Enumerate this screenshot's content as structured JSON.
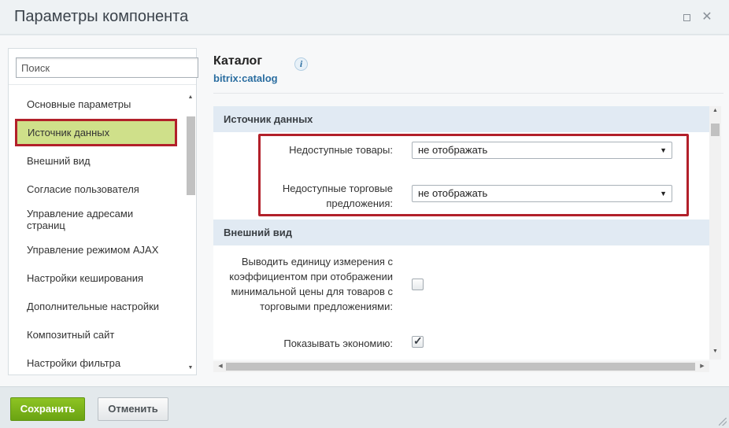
{
  "window": {
    "title": "Параметры компонента"
  },
  "sidebar": {
    "search_placeholder": "Поиск",
    "items": [
      {
        "label": "Основные параметры"
      },
      {
        "label": "Источник данных"
      },
      {
        "label": "Внешний вид"
      },
      {
        "label": "Согласие пользователя"
      },
      {
        "label": "Управление адресами\nстраниц"
      },
      {
        "label": "Управление режимом AJAX"
      },
      {
        "label": "Настройки кеширования"
      },
      {
        "label": "Дополнительные настройки"
      },
      {
        "label": "Композитный сайт"
      },
      {
        "label": "Настройки фильтра"
      }
    ],
    "active_item": "Источник данных"
  },
  "component": {
    "title": "Каталог",
    "code": "bitrix:catalog"
  },
  "properties": {
    "sections": [
      {
        "label": "Источник данных",
        "fields": [
          {
            "label": "Недоступные товары:",
            "type": "select",
            "value": "не отображать"
          },
          {
            "label": "Недоступные торговые\nпредложения:",
            "type": "select",
            "value": "не отображать"
          }
        ]
      },
      {
        "label": "Внешний вид",
        "fields": [
          {
            "label": "Выводить единицу измерения с\nкоэффициентом при отображении\nминимальной цены для товаров с\nторговыми предложениями:",
            "type": "checkbox",
            "checked": false
          },
          {
            "label": "Показывать экономию:",
            "type": "checkbox",
            "checked": true
          }
        ]
      }
    ]
  },
  "footer": {
    "save_label": "Сохранить",
    "cancel_label": "Отменить"
  },
  "colors": {
    "highlight_border": "#b2202a",
    "active_item_bg": "#cfe08a",
    "save_button": "#7ab51d",
    "section_header_bg": "#e1eaf3",
    "link_blue": "#2a6da0"
  }
}
